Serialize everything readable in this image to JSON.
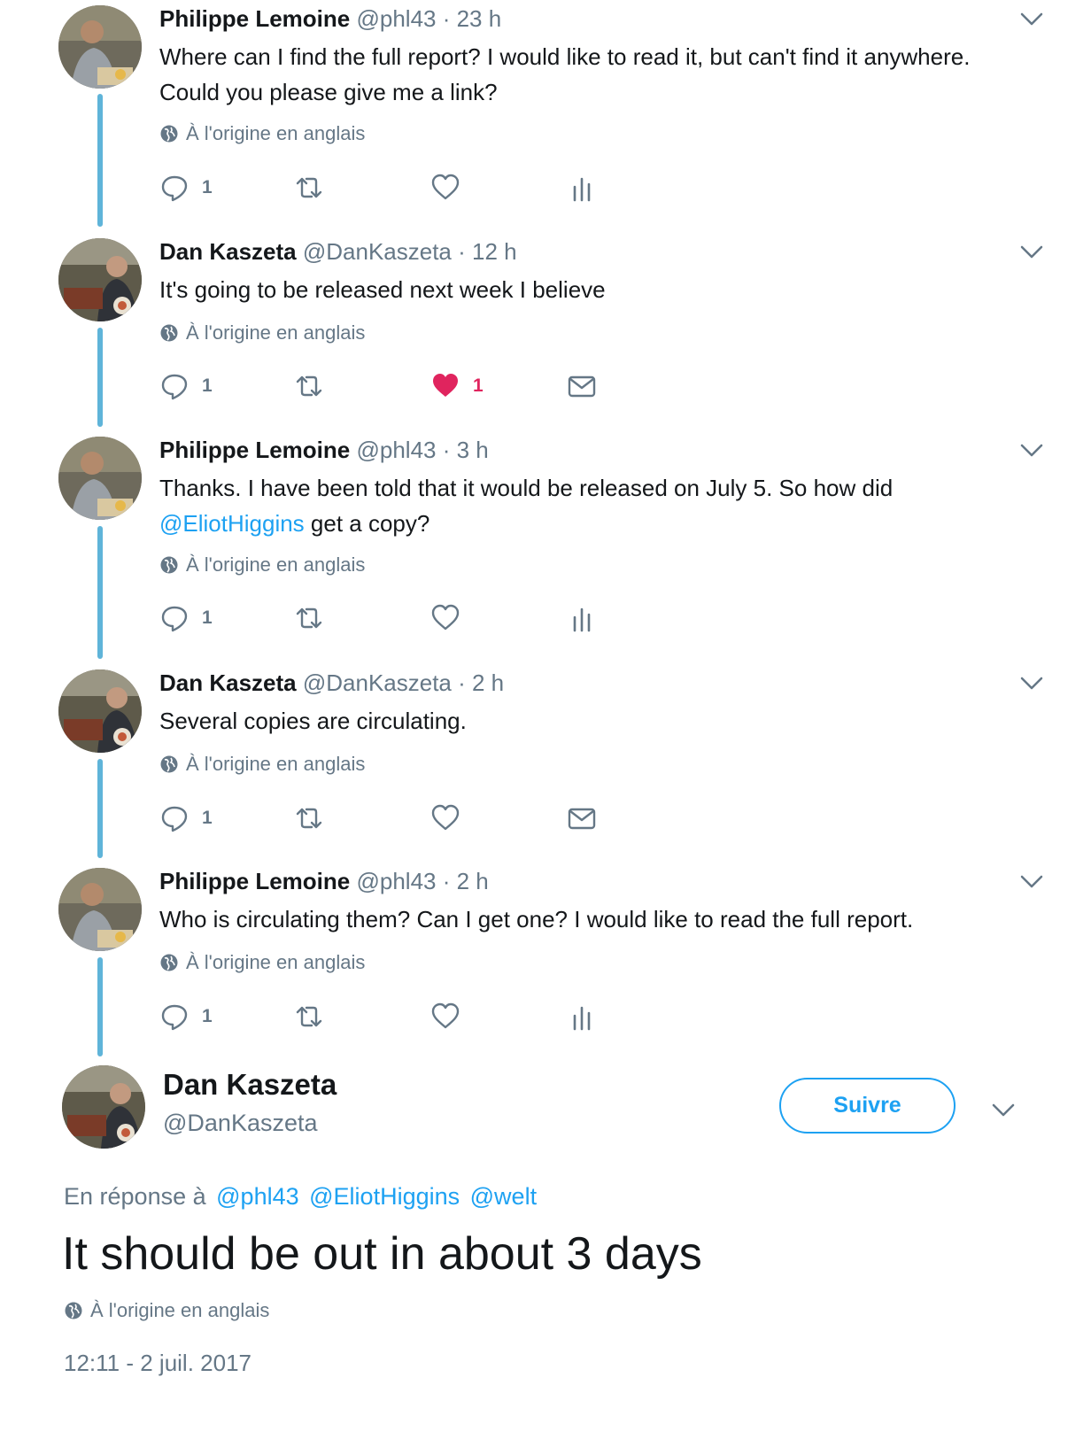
{
  "thread": [
    {
      "name": "Philippe Lemoine",
      "meta": "@phl43 · 23 h",
      "lines": [
        "Where can I find the full report? I would like to read it, but can't find it anywhere.",
        "Could you please give me a link?"
      ],
      "original_lang": "À l'origine en anglais",
      "reply_count": "1",
      "like_count": "",
      "liked": false,
      "fourth_action": "stats-icon"
    },
    {
      "name": "Dan Kaszeta",
      "meta": "@DanKaszeta · 12 h",
      "lines": [
        "It's going to be released next week I believe"
      ],
      "original_lang": "À l'origine en anglais",
      "reply_count": "1",
      "like_count": "1",
      "liked": true,
      "fourth_action": "mail-icon"
    },
    {
      "name": "Philippe Lemoine",
      "meta": "@phl43 · 3 h",
      "line1": "Thanks. I have been told that it would be released on July 5. So how did",
      "line2_mention": "@EliotHiggins",
      "line2_rest": " get a copy?",
      "original_lang": "À l'origine en anglais",
      "reply_count": "1",
      "like_count": "",
      "liked": false,
      "fourth_action": "stats-icon"
    },
    {
      "name": "Dan Kaszeta",
      "meta": "@DanKaszeta · 2 h",
      "lines": [
        "Several copies are circulating."
      ],
      "original_lang": "À l'origine en anglais",
      "reply_count": "1",
      "like_count": "",
      "liked": false,
      "fourth_action": "mail-icon"
    },
    {
      "name": "Philippe Lemoine",
      "meta": "@phl43 · 2 h",
      "lines": [
        "Who is circulating them? Can I get one? I would like to read the full report."
      ],
      "original_lang": "À l'origine en anglais",
      "reply_count": "1",
      "like_count": "",
      "liked": false,
      "fourth_action": "stats-icon"
    }
  ],
  "main": {
    "name": "Dan Kaszeta",
    "handle": "@DanKaszeta",
    "follow_label": "Suivre",
    "reply_prefix": "En réponse à",
    "reply_mentions": [
      "@phl43",
      "@EliotHiggins",
      "@welt"
    ],
    "text": "It should be out in about 3 days",
    "original_lang": "À l'origine en anglais",
    "timestamp": "12:11 - 2 juil. 2017"
  },
  "colors": {
    "accent": "#1da1f2",
    "thread_line": "#5fb4d9",
    "like": "#e0245e",
    "secondary_text": "#657786"
  }
}
